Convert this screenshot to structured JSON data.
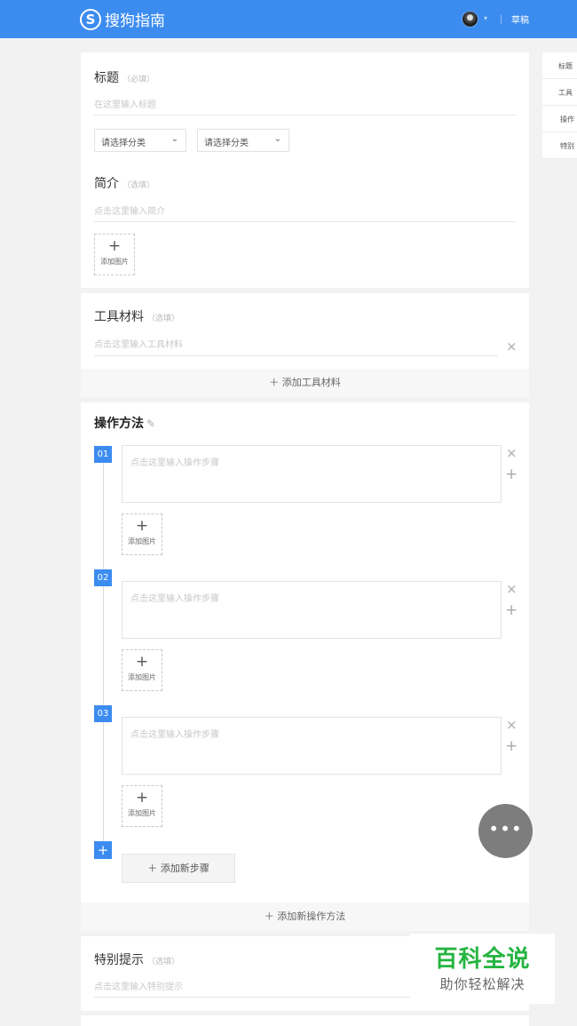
{
  "header": {
    "logo_mark": "S",
    "logo_text": "搜狗指南",
    "caret": "▾",
    "draft_link": "草稿"
  },
  "title_section": {
    "label": "标题",
    "hint": "（必填）",
    "placeholder": "在这里输入标题",
    "category_select_1": "请选择分类",
    "category_select_2": "请选择分类",
    "chevron": "⌄"
  },
  "intro_section": {
    "label": "简介",
    "hint": "（选填）",
    "placeholder": "点击这里输入简介",
    "add_image_plus": "+",
    "add_image_label": "添加图片"
  },
  "tools_section": {
    "label": "工具材料",
    "hint": "（选填）",
    "placeholder": "点击这里输入工具材料",
    "remove": "×",
    "add_button": "＋ 添加工具材料"
  },
  "steps_section": {
    "label": "操作方法",
    "edit_glyph": "✎",
    "steps": [
      {
        "number": "01",
        "placeholder": "点击这里输入操作步骤",
        "remove": "×",
        "add": "+",
        "add_image_plus": "+",
        "add_image_label": "添加图片"
      },
      {
        "number": "02",
        "placeholder": "点击这里输入操作步骤",
        "remove": "×",
        "add": "+",
        "add_image_plus": "+",
        "add_image_label": "添加图片"
      },
      {
        "number": "03",
        "placeholder": "点击这里输入操作步骤",
        "remove": "×",
        "add": "+",
        "add_image_plus": "+",
        "add_image_label": "添加图片"
      }
    ],
    "add_step_marker": "+",
    "add_step_button": "＋ 添加新步骤",
    "add_method_button": "＋ 添加新操作方法"
  },
  "tips_section": {
    "label": "特别提示",
    "hint": "（选填）",
    "placeholder": "点击这里输入特别提示"
  },
  "right_nav": {
    "items": [
      "标题",
      "工具",
      "操作",
      "特别"
    ]
  },
  "fab": {
    "label": "•••"
  },
  "watermark": {
    "title": "百科全说",
    "subtitle": "助你轻松解决"
  },
  "colors": {
    "brand": "#3c8cf0",
    "watermark_green": "#25b440",
    "fab": "#7d7d7d"
  }
}
